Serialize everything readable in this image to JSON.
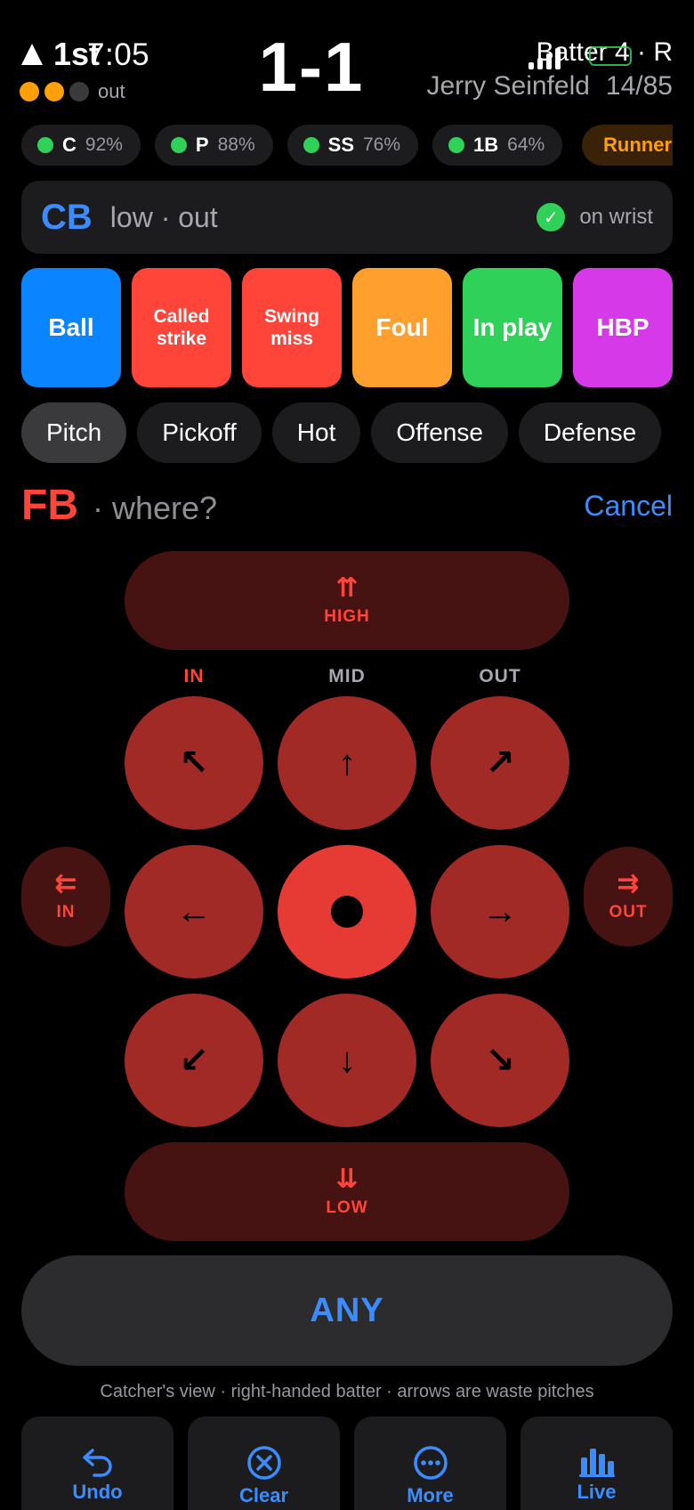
{
  "header": {
    "inning": "1st",
    "clock": "7:05",
    "outs_label": "out",
    "outs_dots": [
      "#ff9f0a",
      "#ff9f0a",
      "#3a3a3c"
    ],
    "score": "1-1",
    "batter_line": "Batter 4 · R",
    "batter_name": "Jerry Seinfeld",
    "pitch_count": "14/85"
  },
  "fielders": [
    {
      "pos": "C",
      "pct": "92%"
    },
    {
      "pos": "P",
      "pct": "88%"
    },
    {
      "pos": "SS",
      "pct": "76%"
    },
    {
      "pos": "1B",
      "pct": "64%"
    }
  ],
  "runners_label": "Runners",
  "call": {
    "pitch": "CB",
    "location": "low · out",
    "wrist_label": "on wrist",
    "check": "✓"
  },
  "outcomes": [
    {
      "label": "Ball",
      "color": "#0a84ff",
      "size": "big"
    },
    {
      "label": "Called strike",
      "color": "#ff453a",
      "size": "small"
    },
    {
      "label": "Swing miss",
      "color": "#ff453a",
      "size": "small"
    },
    {
      "label": "Foul",
      "color": "#ff9f2d",
      "size": "big"
    },
    {
      "label": "In play",
      "color": "#30d158",
      "size": "big"
    },
    {
      "label": "HBP",
      "color": "#d63ae8",
      "size": "big"
    }
  ],
  "tabs": [
    "Pitch",
    "Pickoff",
    "Hot",
    "Offense",
    "Defense"
  ],
  "active_tab": "Pitch",
  "prompt": {
    "pitch": "FB",
    "where": "· where?",
    "cancel": "Cancel"
  },
  "zone": {
    "high_arrow": "⇈",
    "high_label": "HIGH",
    "low_arrow": "⇊",
    "low_label": "LOW",
    "col_in": "IN",
    "col_mid": "MID",
    "col_out": "OUT",
    "side_in_arrow": "⇇",
    "side_in_label": "IN",
    "side_out_arrow": "⇉",
    "side_out_label": "OUT",
    "arrows": {
      "up_left": "↖",
      "up": "↑",
      "up_right": "↗",
      "left": "←",
      "right": "→",
      "down_left": "↙",
      "down": "↓",
      "down_right": "↘"
    },
    "any": "ANY"
  },
  "note": "Catcher's view · right-handed batter · arrows are waste pitches",
  "toolbar": {
    "undo": "Undo",
    "clear": "Clear",
    "more": "More",
    "live": "Live"
  }
}
